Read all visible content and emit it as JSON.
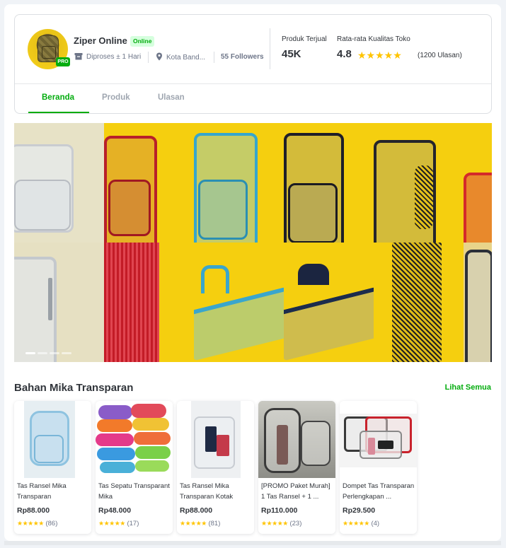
{
  "shop": {
    "name": "Ziper Online",
    "status": "Online",
    "badge": "PRO",
    "processing": "Diproses ± 1 Hari",
    "location": "Kota Band...",
    "followers": "55 Followers",
    "sold_label": "Produk Terjual",
    "sold_value": "45K",
    "rating_label": "Rata-rata Kualitas Toko",
    "rating_value": "4.8",
    "rating_stars": "★★★★★",
    "review_count": "(1200 Ulasan)"
  },
  "tabs": [
    {
      "label": "Beranda",
      "active": true
    },
    {
      "label": "Produk",
      "active": false
    },
    {
      "label": "Ulasan",
      "active": false
    }
  ],
  "banner": {
    "slides": 4,
    "active_slide": 1
  },
  "section": {
    "title": "Bahan Mika Transparan",
    "see_all": "Lihat Semua"
  },
  "products": [
    {
      "name": "Tas Ransel Mika Transparan",
      "price": "Rp88.000",
      "stars": "★★★★★",
      "reviews": "(86)"
    },
    {
      "name": "Tas Sepatu Transparant Mika",
      "price": "Rp48.000",
      "stars": "★★★★★",
      "reviews": "(17)"
    },
    {
      "name": "Tas Ransel Mika Transparan Kotak Lapto...",
      "price": "Rp88.000",
      "stars": "★★★★★",
      "reviews": "(81)"
    },
    {
      "name": "[PROMO Paket Murah] 1 Tas Ransel + 1 ...",
      "price": "Rp110.000",
      "stars": "★★★★★",
      "reviews": "(23)"
    },
    {
      "name": "Dompet Tas Transparan Perlengkapan ...",
      "price": "Rp29.500",
      "stars": "★★★★★",
      "reviews": "(4)"
    }
  ],
  "colors": {
    "accent": "#03ac0e",
    "star": "#ffc400",
    "banner_bg": "#f5cf0f"
  },
  "icons": {
    "processing": "package-icon",
    "location": "location-pin-icon"
  }
}
